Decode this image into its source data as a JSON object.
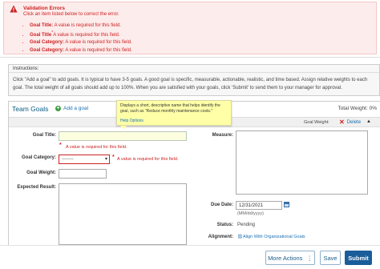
{
  "validation": {
    "title": "Validation Errors",
    "subtitle": "Click an item listed below to correct the error.",
    "items": [
      {
        "field": "Goal Title:",
        "message": " A value is required for this field."
      },
      {
        "field": "Goal Title",
        "message": "A value is required for this field."
      },
      {
        "field": "Goal Category:",
        "message": " A value is required for this field."
      },
      {
        "field": "Goal Category:",
        "message": " A value is required for this field."
      }
    ]
  },
  "instructions": {
    "heading": "Instructions:",
    "body": "Click \"Add a goal\" to add goals. It is typical to have 3-5 goals. A good goal is specific, measurable, actionable, realistic, and time based. Assign relative weights to each goal. The total weight of all goals should add up to 100%. When you are satisfied with your goals, click 'Submit' to send them to your manager for approval."
  },
  "team_goals": {
    "title": "Team Goals",
    "add_label": "Add a goal",
    "total_weight": "Total Weight: 0%",
    "goal_weight_label": "Goal Weight:",
    "delete_label": "Delete",
    "collapse_glyph": "▲"
  },
  "tooltip": {
    "text": "Displays a short, descriptive name that helps identify the goal, such as \"Reduce monthly maintenance costs.\"",
    "help": "Help Options"
  },
  "form": {
    "goal_title_label": "Goal Title:",
    "goal_category_label": "Goal Category:",
    "goal_weight_label": "Goal Weight:",
    "expected_result_label": "Expected Result:",
    "measure_label": "Measure:",
    "due_date_label": "Due Date:",
    "status_label": "Status:",
    "alignment_label": "Alignment:",
    "error_message": "A value is required for this field.",
    "error_star": "*",
    "category_selected": "--------",
    "due_date_value": "12/31/2021",
    "date_format": "(MM/dd/yyyy)",
    "status_value": "Pending",
    "align_link": "Align With Organizational Goals"
  },
  "footer": {
    "more_actions": "More Actions",
    "more_glyph": "⋮",
    "save": "Save",
    "submit": "Submit"
  },
  "colors": {
    "error": "#cc2222",
    "link": "#1a6fb3",
    "primary": "#1a5d9a"
  }
}
